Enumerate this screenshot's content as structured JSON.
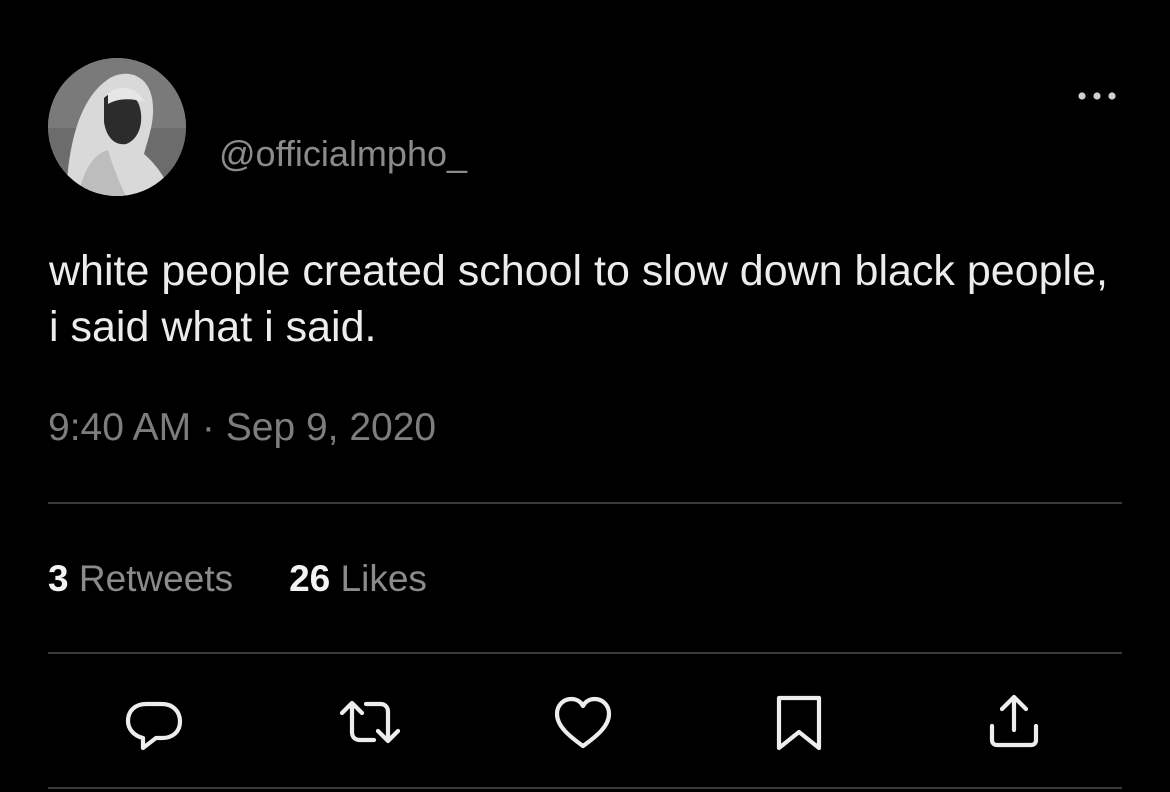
{
  "tweet": {
    "handle": "@officialmpho_",
    "text": "white people created school to slow down black people, i said what i said.",
    "timestamp": "9:40 AM · Sep 9, 2020"
  },
  "stats": {
    "retweets_count": "3",
    "retweets_label": "Retweets",
    "likes_count": "26",
    "likes_label": "Likes"
  },
  "actions": [
    {
      "icon": "reply-icon"
    },
    {
      "icon": "retweet-icon"
    },
    {
      "icon": "like-icon"
    },
    {
      "icon": "bookmark-icon"
    },
    {
      "icon": "share-icon"
    }
  ],
  "menu": {
    "icon": "more-options-icon"
  },
  "colors": {
    "background": "#000000",
    "text": "#ececec",
    "secondary_text": "#8b8b8b",
    "divider": "#3a3a3a",
    "icon": "#ededed"
  }
}
